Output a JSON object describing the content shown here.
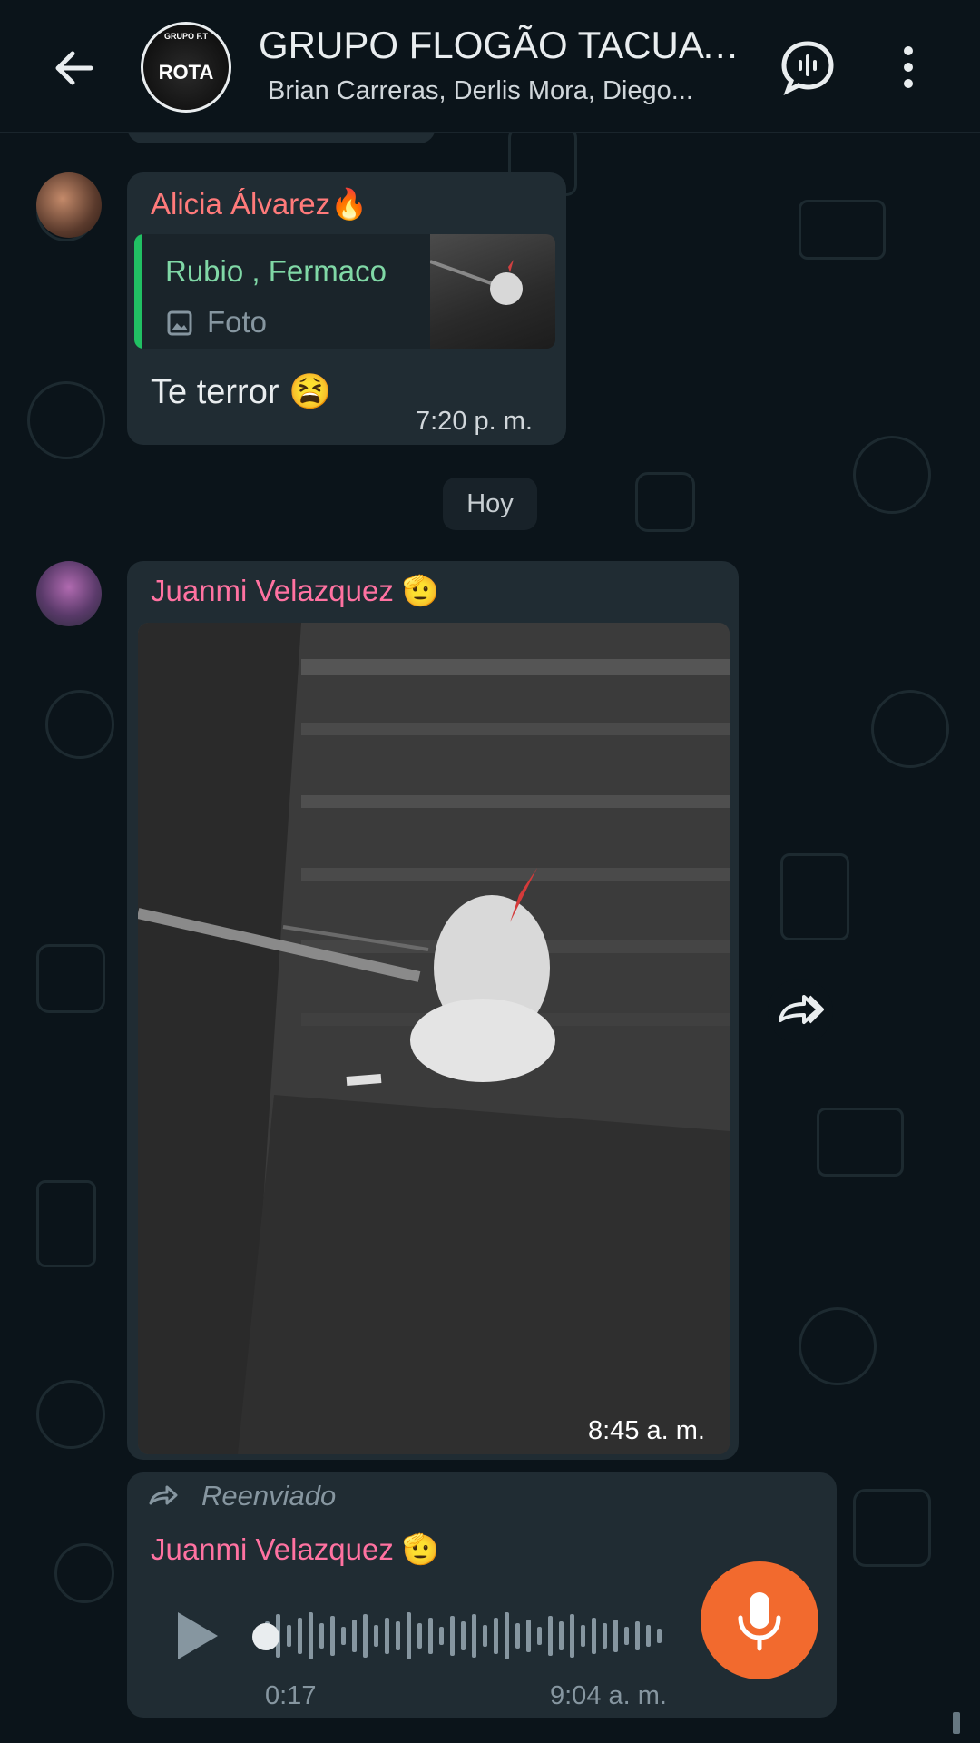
{
  "header": {
    "group_name": "GRUPO FLOGÃO TACUAT...",
    "members": "Brian Carreras, Derlis Mora, Diego...",
    "avatar_top_text": "GRUPO F.T",
    "avatar_text": "ROTA",
    "back_icon": "arrow-left-icon",
    "call_icon": "voice-chat-icon",
    "menu_icon": "more-vertical-icon"
  },
  "messages": [
    {
      "sender": "Alicia Álvarez🔥",
      "sender_color": "#ff7a7a",
      "quote_author": "Rubio , Fermaco",
      "quote_type": "Foto",
      "text": "Te terror 😫",
      "time": "7:20 p. m."
    },
    {
      "sender": "Juanmi Velazquez 🫡",
      "sender_color": "#ff72a1",
      "time": "8:45 a. m."
    },
    {
      "forwarded_label": "Reenviado",
      "sender": "Juanmi Velazquez 🫡",
      "sender_color": "#ff72a1",
      "duration": "0:17",
      "time": "9:04 a. m."
    }
  ],
  "date_divider": "Hoy",
  "colors": {
    "background": "#0b141a",
    "bubble": "#202c33",
    "accent_green": "#21c063",
    "mic_button": "#f26a2e"
  }
}
